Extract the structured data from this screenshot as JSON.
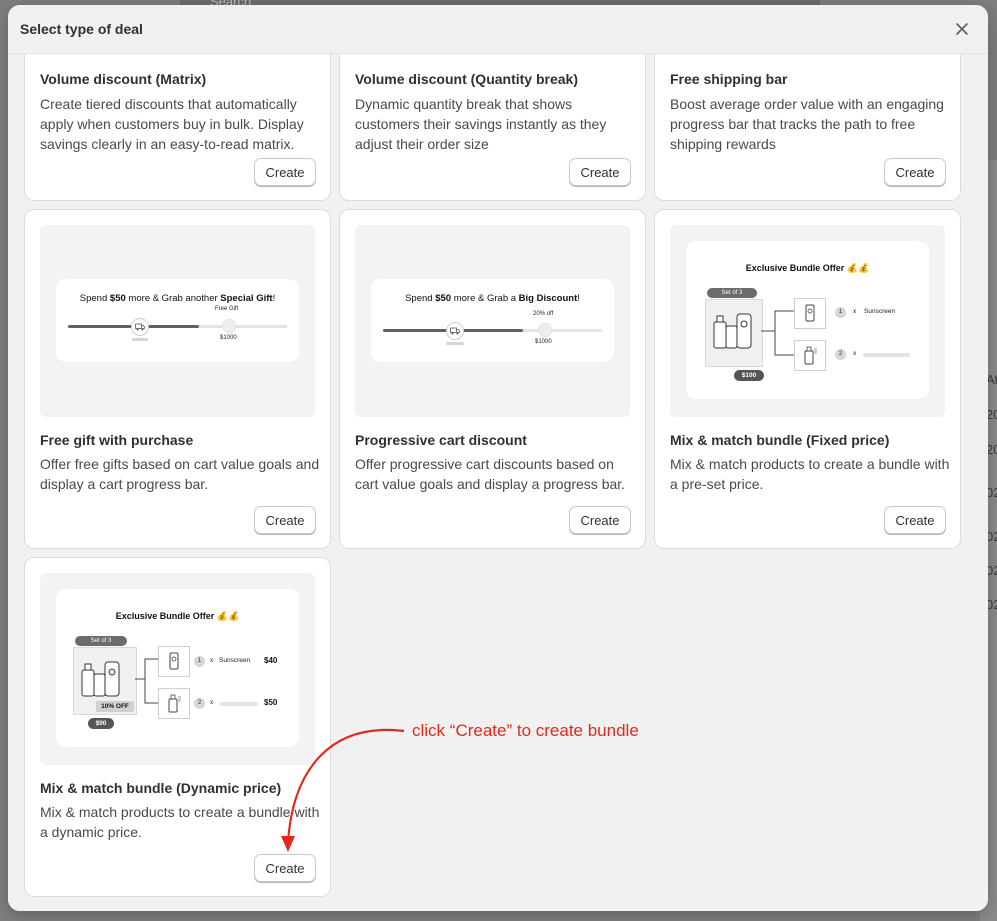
{
  "background": {
    "search_placeholder": "Search",
    "right_edge_texts": [
      "At",
      "20",
      "20",
      "02",
      "02",
      "02",
      "02"
    ]
  },
  "modal": {
    "title": "Select type of deal",
    "close_label": "×"
  },
  "cards": [
    {
      "title": "Volume discount (Matrix)",
      "description": "Create tiered discounts that automatically apply when customers buy in bulk. Display savings clearly in an easy-to-read matrix.",
      "button": "Create"
    },
    {
      "title": "Volume discount (Quantity break)",
      "description": "Dynamic quantity break that shows customers their savings instantly as they adjust their order size",
      "button": "Create"
    },
    {
      "title": "Free shipping bar",
      "description": "Boost average order value with an engaging progress bar that tracks the path to free shipping rewards",
      "button": "Create"
    },
    {
      "title": "Free gift with purchase",
      "description": "Offer free gifts based on cart value goals and display a cart progress bar.",
      "button": "Create",
      "preview": {
        "headline_pre": "Spend ",
        "headline_amount": "$50",
        "headline_mid": " more & Grab another ",
        "headline_bold": "Special Gift",
        "headline_post": "!",
        "tier_label": "Free Gift",
        "tier_amount": "$1000",
        "progress": 0.6
      }
    },
    {
      "title": "Progressive cart discount",
      "description": "Offer progressive cart discounts based on cart value goals and display a progress bar.",
      "button": "Create",
      "preview": {
        "headline_pre": "Spend ",
        "headline_amount": "$50",
        "headline_mid": " more & Grab a ",
        "headline_bold": "Big Discount",
        "headline_post": "!",
        "tier_label": "20% off",
        "tier_amount": "$1000",
        "progress": 0.64
      }
    },
    {
      "title": "Mix & match bundle (Fixed price)",
      "description": "Mix & match products to create a bundle with a pre-set price.",
      "button": "Create",
      "preview": {
        "headline": "Exclusive Bundle Offer 💰💰",
        "set_label": "Set of 3",
        "price": "$100",
        "item1_num": "1",
        "item1_x": "x",
        "item1_name": "Sunscreen",
        "item2_num": "2",
        "item2_x": "x"
      }
    },
    {
      "title": "Mix & match bundle (Dynamic price)",
      "description": "Mix & match products to create a bundle with a dynamic price.",
      "button": "Create",
      "preview": {
        "headline": "Exclusive Bundle Offer 💰💰",
        "set_label": "Set of 3",
        "discount": "10% OFF",
        "price": "$90",
        "item1_num": "1",
        "item1_x": "x",
        "item1_name": "Sunscreen",
        "item1_price": "$40",
        "item2_num": "2",
        "item2_x": "x",
        "item2_price": "$50"
      }
    }
  ],
  "annotation": {
    "text": "click “Create” to create bundle",
    "color": "#e1291c"
  },
  "colors": {
    "overlay": "#7f7f7f",
    "modal_header": "#f1f1f1",
    "card_border": "#dcdcdc",
    "progress_fill": "#616161"
  }
}
